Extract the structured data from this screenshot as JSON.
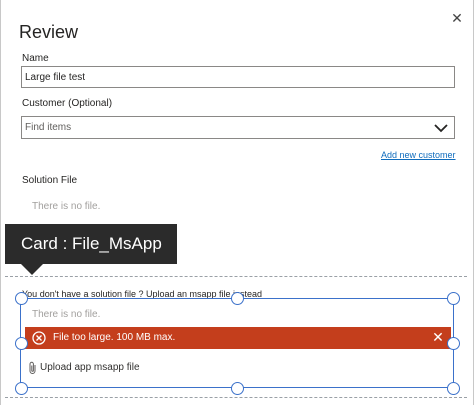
{
  "header": {
    "title": "Review",
    "close_icon": "close-icon"
  },
  "name": {
    "label": "Name",
    "value": "Large file test"
  },
  "customer": {
    "label": "Customer (Optional)",
    "placeholder": "Find items",
    "add_link": "Add new customer"
  },
  "solution_file": {
    "label": "Solution File",
    "empty_text": "There is no file."
  },
  "tooltip": {
    "text": "Card : File_MsApp"
  },
  "msapp_card": {
    "prompt": "You don't have a solution file ? Upload an msapp file instead",
    "empty_text": "There is no file.",
    "error_text": "File too large. 100 MB max.",
    "upload_label": "Upload app msapp file"
  },
  "colors": {
    "error": "#c43e1c",
    "link": "#0f6cbd",
    "selection": "#3b71ca",
    "tooltip": "#2b2b2b"
  }
}
